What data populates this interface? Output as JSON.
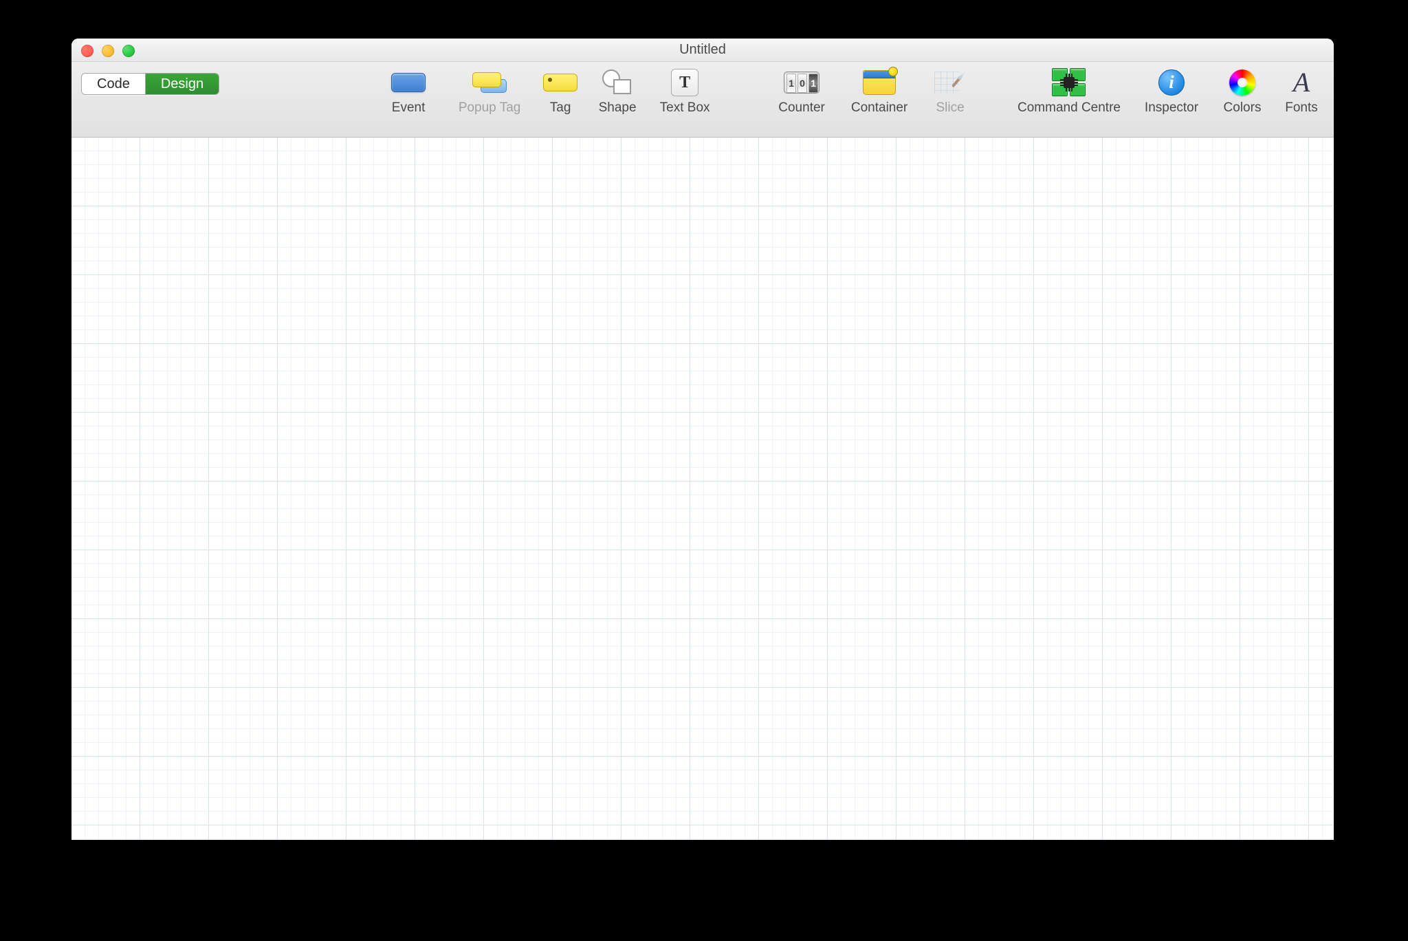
{
  "window": {
    "title": "Untitled"
  },
  "view_toggle": {
    "code": "Code",
    "design": "Design",
    "active": "design"
  },
  "toolbar": {
    "items": [
      {
        "id": "event",
        "label": "Event",
        "icon": "event-icon",
        "enabled": true
      },
      {
        "id": "popup_tag",
        "label": "Popup Tag",
        "icon": "popup-tag-icon",
        "enabled": false
      },
      {
        "id": "tag",
        "label": "Tag",
        "icon": "tag-icon",
        "enabled": true
      },
      {
        "id": "shape",
        "label": "Shape",
        "icon": "shape-icon",
        "enabled": true
      },
      {
        "id": "text_box",
        "label": "Text Box",
        "icon": "text-box-icon",
        "enabled": true
      },
      {
        "id": "counter",
        "label": "Counter",
        "icon": "counter-icon",
        "enabled": true
      },
      {
        "id": "container",
        "label": "Container",
        "icon": "container-icon",
        "enabled": true
      },
      {
        "id": "slice",
        "label": "Slice",
        "icon": "slice-icon",
        "enabled": false
      }
    ],
    "right": [
      {
        "id": "command_centre",
        "label": "Command Centre",
        "icon": "command-centre-icon"
      },
      {
        "id": "inspector",
        "label": "Inspector",
        "icon": "inspector-icon"
      },
      {
        "id": "colors",
        "label": "Colors",
        "icon": "colors-icon"
      },
      {
        "id": "fonts",
        "label": "Fonts",
        "icon": "fonts-icon"
      }
    ]
  },
  "textbox_letter": "T",
  "info_letter": "i",
  "fonts_letter": "A",
  "counter_digits": [
    "1",
    "0",
    "1"
  ]
}
